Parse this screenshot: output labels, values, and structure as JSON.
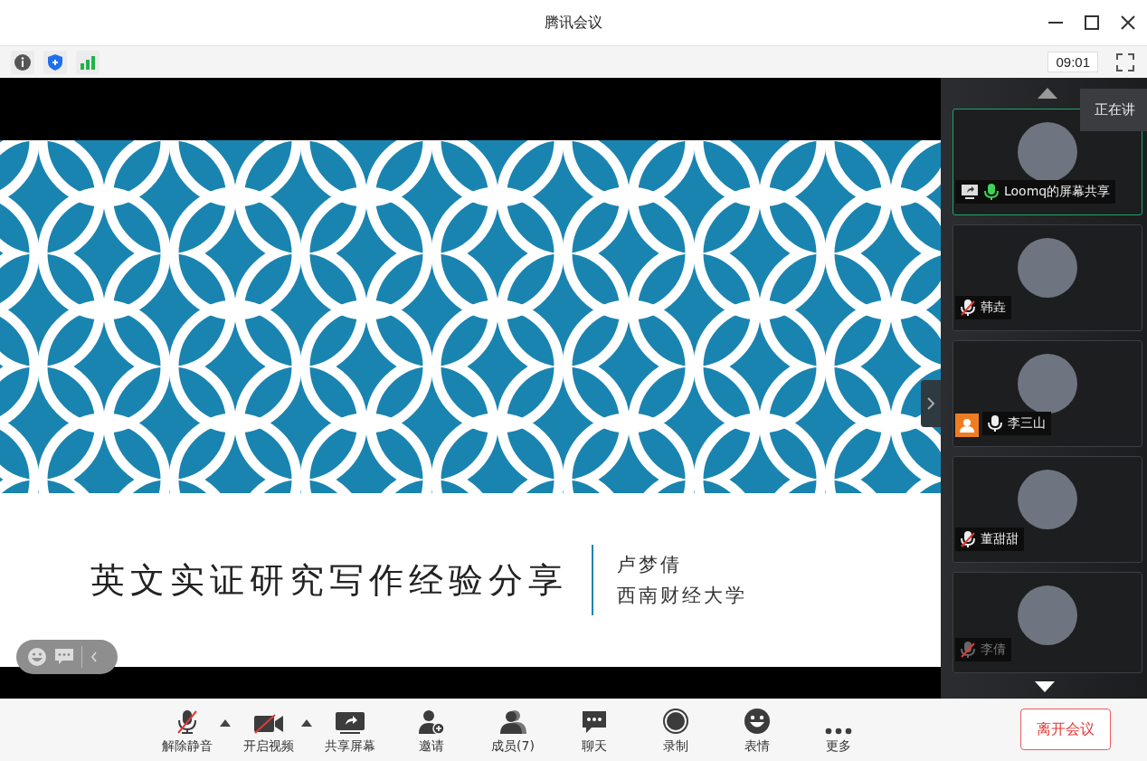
{
  "window": {
    "title": "腾讯会议"
  },
  "info_bar": {
    "clock": "09:01"
  },
  "slide": {
    "title": "英文实证研究写作经验分享",
    "author": "卢梦倩",
    "affiliation": "西南财经大学"
  },
  "speaking_tooltip": "正在讲",
  "participants": [
    {
      "name": "Loomq的屏幕共享",
      "muted": false,
      "screen_share": true,
      "host": false,
      "selected": true,
      "dimmed": false
    },
    {
      "name": "韩垚",
      "muted": true,
      "screen_share": false,
      "host": false,
      "selected": false,
      "dimmed": false
    },
    {
      "name": "李三山",
      "muted": false,
      "screen_share": false,
      "host": true,
      "selected": false,
      "dimmed": false
    },
    {
      "name": "董甜甜",
      "muted": true,
      "screen_share": false,
      "host": false,
      "selected": false,
      "dimmed": false
    },
    {
      "name": "李倩",
      "muted": true,
      "screen_share": false,
      "host": false,
      "selected": false,
      "dimmed": true
    }
  ],
  "toolbar": [
    {
      "kind": "mic",
      "label": "解除静音",
      "off": true,
      "menu": true
    },
    {
      "kind": "video",
      "label": "开启视频",
      "off": true,
      "menu": true
    },
    {
      "kind": "share",
      "label": "共享屏幕",
      "off": false,
      "menu": false
    },
    {
      "kind": "invite",
      "label": "邀请",
      "off": false,
      "menu": false
    },
    {
      "kind": "members",
      "label": "成员(7)",
      "off": false,
      "menu": false
    },
    {
      "kind": "chat",
      "label": "聊天",
      "off": false,
      "menu": false
    },
    {
      "kind": "record",
      "label": "录制",
      "off": false,
      "menu": false
    },
    {
      "kind": "emoji",
      "label": "表情",
      "off": false,
      "menu": false
    },
    {
      "kind": "more",
      "label": "更多",
      "off": false,
      "menu": false
    }
  ],
  "leave_button": "离开会议"
}
